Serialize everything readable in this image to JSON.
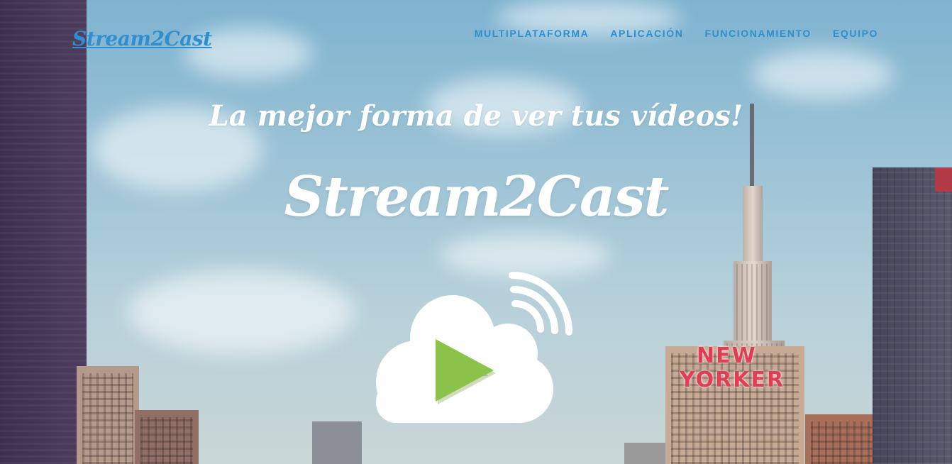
{
  "header": {
    "logo_text": "Stream2Cast",
    "nav": [
      {
        "label": "MULTIPLATAFORMA"
      },
      {
        "label": "APLICACIÓN"
      },
      {
        "label": "FUNCIONAMIENTO"
      },
      {
        "label": "EQUIPO"
      }
    ]
  },
  "hero": {
    "tagline": "La mejor forma de ver tus vídeos!",
    "brand": "Stream2Cast",
    "icon": "cloud-play-cast-icon",
    "sign_line_1": "NEW",
    "sign_line_2": "YORKER"
  },
  "colors": {
    "brand_blue": "#2e8fd0",
    "play_green": "#8bc34a",
    "white": "#ffffff",
    "neon_red": "#e33d55"
  }
}
